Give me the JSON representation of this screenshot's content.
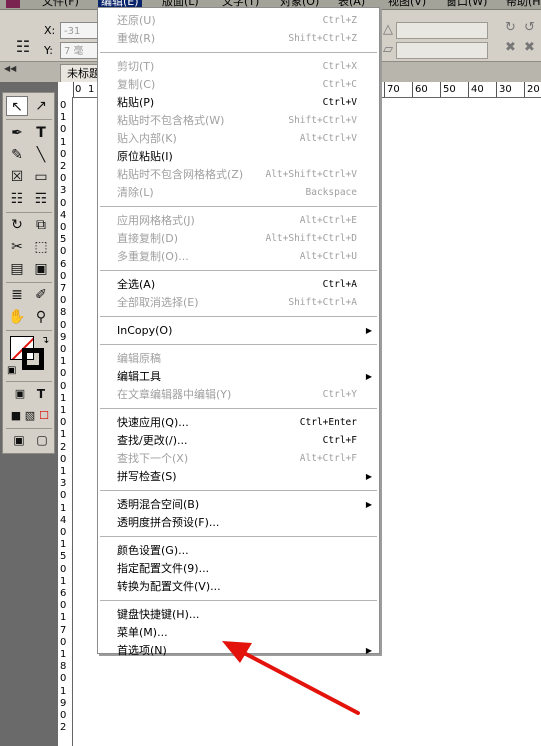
{
  "menubar": {
    "items": [
      {
        "label": "文件(F)",
        "active": false
      },
      {
        "label": "编辑(E)",
        "active": true
      },
      {
        "label": "版面(L)",
        "active": false
      },
      {
        "label": "文字(T)",
        "active": false
      },
      {
        "label": "对象(O)",
        "active": false
      },
      {
        "label": "表(A)",
        "active": false
      },
      {
        "label": "视图(V)",
        "active": false
      },
      {
        "label": "窗口(W)",
        "active": false
      },
      {
        "label": "帮助(H)",
        "active": false
      }
    ]
  },
  "control_panel": {
    "x_label": "X:",
    "y_label": "Y:",
    "x_value": "-31",
    "y_value": "7 毫"
  },
  "document_tab": {
    "title": "未标题"
  },
  "ruler_top_numbers": [
    "0",
    "1",
    "70",
    "60",
    "50",
    "40",
    "30",
    "20"
  ],
  "ruler_left_numbers": [
    "0",
    "1",
    "0",
    "1",
    "0",
    "2",
    "0",
    "3",
    "0",
    "4",
    "0",
    "5",
    "0",
    "6",
    "0",
    "7",
    "0",
    "8",
    "0",
    "9",
    "0",
    "1",
    "0",
    "0",
    "1",
    "1",
    "0",
    "1",
    "2",
    "0",
    "1",
    "3",
    "0",
    "1",
    "4",
    "0",
    "1",
    "5",
    "0",
    "1",
    "6",
    "0",
    "1",
    "7",
    "0",
    "1",
    "8",
    "0",
    "1",
    "9",
    "0",
    "2"
  ],
  "edit_menu": {
    "items": [
      {
        "label": "还原(U)",
        "shortcut": "Ctrl+Z",
        "enabled": false
      },
      {
        "label": "重做(R)",
        "shortcut": "Shift+Ctrl+Z",
        "enabled": false
      },
      {
        "label": "剪切(T)",
        "shortcut": "Ctrl+X",
        "enabled": false
      },
      {
        "label": "复制(C)",
        "shortcut": "Ctrl+C",
        "enabled": false
      },
      {
        "label": "粘贴(P)",
        "shortcut": "Ctrl+V",
        "enabled": true
      },
      {
        "label": "粘贴时不包含格式(W)",
        "shortcut": "Shift+Ctrl+V",
        "enabled": false
      },
      {
        "label": "贴入内部(K)",
        "shortcut": "Alt+Ctrl+V",
        "enabled": false
      },
      {
        "label": "原位粘贴(I)",
        "shortcut": "",
        "enabled": true
      },
      {
        "label": "粘贴时不包含网格格式(Z)",
        "shortcut": "Alt+Shift+Ctrl+V",
        "enabled": false
      },
      {
        "label": "清除(L)",
        "shortcut": "Backspace",
        "enabled": false
      },
      {
        "label": "应用网格格式(J)",
        "shortcut": "Alt+Ctrl+E",
        "enabled": false
      },
      {
        "label": "直接复制(D)",
        "shortcut": "Alt+Shift+Ctrl+D",
        "enabled": false
      },
      {
        "label": "多重复制(O)...",
        "shortcut": "Alt+Ctrl+U",
        "enabled": false
      },
      {
        "label": "全选(A)",
        "shortcut": "Ctrl+A",
        "enabled": true
      },
      {
        "label": "全部取消选择(E)",
        "shortcut": "Shift+Ctrl+A",
        "enabled": false
      },
      {
        "label": "InCopy(O)",
        "shortcut": "",
        "enabled": true,
        "submenu": true
      },
      {
        "label": "编辑原稿",
        "shortcut": "",
        "enabled": false
      },
      {
        "label": "编辑工具",
        "shortcut": "",
        "enabled": true,
        "submenu": true
      },
      {
        "label": "在文章编辑器中编辑(Y)",
        "shortcut": "Ctrl+Y",
        "enabled": false
      },
      {
        "label": "快速应用(Q)...",
        "shortcut": "Ctrl+Enter",
        "enabled": true
      },
      {
        "label": "查找/更改(/)...",
        "shortcut": "Ctrl+F",
        "enabled": true
      },
      {
        "label": "查找下一个(X)",
        "shortcut": "Alt+Ctrl+F",
        "enabled": false
      },
      {
        "label": "拼写检查(S)",
        "shortcut": "",
        "enabled": true,
        "submenu": true
      },
      {
        "label": "透明混合空间(B)",
        "shortcut": "",
        "enabled": true,
        "submenu": true
      },
      {
        "label": "透明度拼合预设(F)...",
        "shortcut": "",
        "enabled": true
      },
      {
        "label": "颜色设置(G)...",
        "shortcut": "",
        "enabled": true
      },
      {
        "label": "指定配置文件(9)...",
        "shortcut": "",
        "enabled": true
      },
      {
        "label": "转换为配置文件(V)...",
        "shortcut": "",
        "enabled": true
      },
      {
        "label": "键盘快捷键(H)...",
        "shortcut": "",
        "enabled": true
      },
      {
        "label": "菜单(M)...",
        "shortcut": "",
        "enabled": true
      },
      {
        "label": "首选项(N)",
        "shortcut": "",
        "enabled": true,
        "submenu": true
      }
    ]
  },
  "colors": {
    "menu_enabled_text": "#000000",
    "menu_disabled_text": "#a0a0a0",
    "annotation_arrow": "#e3120b",
    "panel_bg": "#d4d0c8",
    "workspace_bg": "#6a6a6a"
  },
  "icons": {
    "annotation": "red-arrow-pointing-to-preferences"
  }
}
